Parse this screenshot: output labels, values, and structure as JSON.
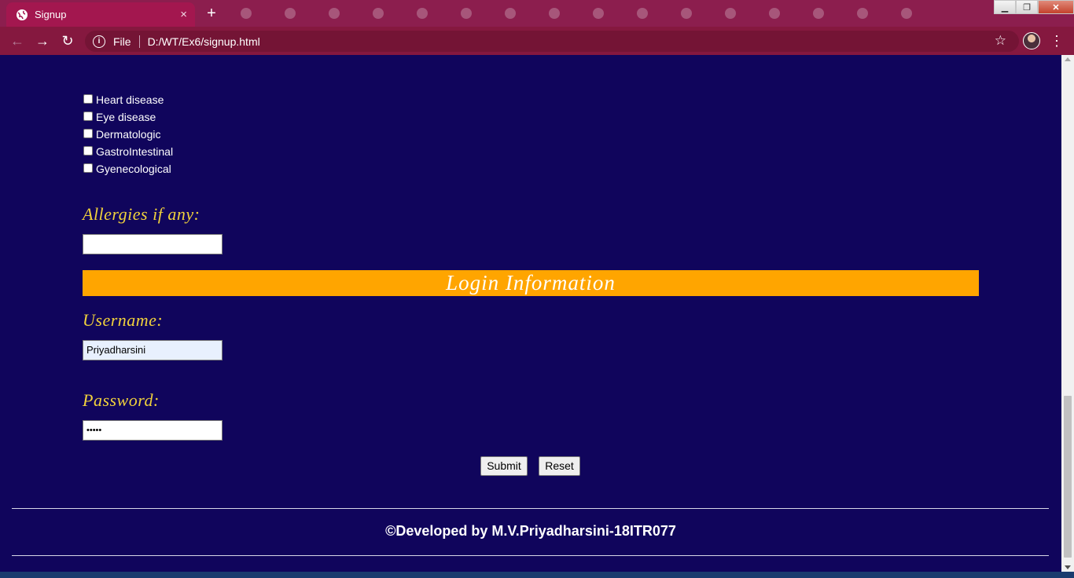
{
  "browser": {
    "tab_title": "Signup",
    "tab_close_icon": "×",
    "new_tab_icon": "+",
    "file_label": "File",
    "url": "D:/WT/Ex6/signup.html",
    "window_controls": {
      "minimize": "▁",
      "restore": "❐",
      "close": "✕"
    }
  },
  "form": {
    "diseases": [
      {
        "label": "Heart disease",
        "checked": false
      },
      {
        "label": "Eye disease",
        "checked": false
      },
      {
        "label": "Dermatologic",
        "checked": false
      },
      {
        "label": "GastroIntestinal",
        "checked": false
      },
      {
        "label": "Gyenecological",
        "checked": false
      }
    ],
    "allergies_label": "Allergies if any:",
    "allergies_value": "",
    "login_section_title": "Login Information",
    "username_label": "Username:",
    "username_value": "Priyadharsini",
    "password_label": "Password:",
    "password_value": "•••••",
    "submit_label": "Submit",
    "reset_label": "Reset"
  },
  "footer": {
    "text": "©Developed by M.V.Priyadharsini-18ITR077"
  },
  "colors": {
    "page_background": "#10055c",
    "section_bar": "#ffa500",
    "label_text": "#f0d13c",
    "browser_frame": "#8c1e4e"
  }
}
